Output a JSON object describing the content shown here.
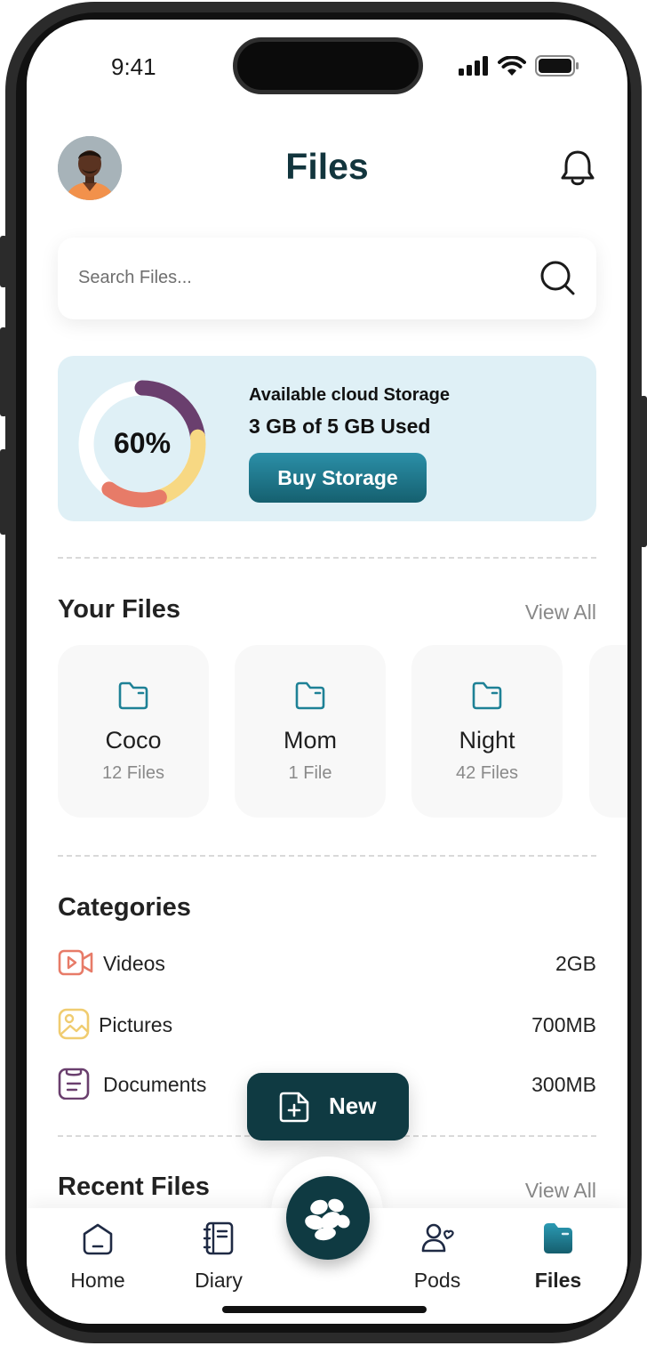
{
  "status_bar": {
    "time": "9:41"
  },
  "header": {
    "title": "Files"
  },
  "search": {
    "placeholder": "Search Files..."
  },
  "storage": {
    "percent_label": "60%",
    "title": "Available cloud Storage",
    "used": "3 GB of 5 GB Used",
    "buy_label": "Buy Storage",
    "segments": [
      {
        "name": "purple",
        "fraction": 0.23,
        "color": "#6a3f6e"
      },
      {
        "name": "yellow",
        "fraction": 0.22,
        "color": "#f7d883"
      },
      {
        "name": "coral",
        "fraction": 0.15,
        "color": "#e77b68"
      }
    ]
  },
  "your_files": {
    "title": "Your Files",
    "view_all": "View All",
    "folders": [
      {
        "name": "Coco",
        "count": "12 Files"
      },
      {
        "name": "Mom",
        "count": "1 File"
      },
      {
        "name": "Night",
        "count": "42 Files"
      }
    ]
  },
  "categories": {
    "title": "Categories",
    "items": [
      {
        "label": "Videos",
        "size": "2GB",
        "icon": "video-icon",
        "color": "#e77b68"
      },
      {
        "label": "Pictures",
        "size": "700MB",
        "icon": "picture-icon",
        "color": "#f0cc70"
      },
      {
        "label": "Documents",
        "size": "300MB",
        "icon": "document-icon",
        "color": "#6a3f6e"
      }
    ]
  },
  "new_button": {
    "label": "New"
  },
  "recent_files": {
    "title": "Recent Files",
    "view_all": "View All"
  },
  "tabbar": {
    "items": [
      {
        "label": "Home",
        "icon": "home-icon"
      },
      {
        "label": "Diary",
        "icon": "diary-icon"
      },
      {
        "label": "Pods",
        "icon": "pods-icon"
      },
      {
        "label": "Files",
        "icon": "files-icon",
        "active": true
      }
    ]
  },
  "colors": {
    "brand_dark": "#0f3a42",
    "title": "#12353d",
    "accent": "#1e8196",
    "card_bg": "#dff0f6"
  }
}
